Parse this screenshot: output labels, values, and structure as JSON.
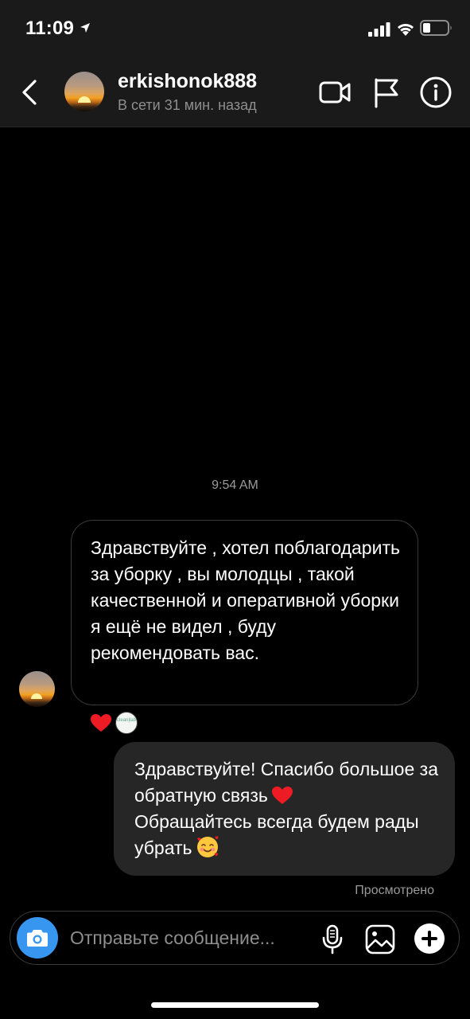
{
  "status_bar": {
    "time": "11:09",
    "icons": [
      "location-arrow-icon",
      "cellular-signal-icon",
      "wifi-icon",
      "battery-icon"
    ]
  },
  "header": {
    "username": "erkishonok888",
    "presence": "В сети 31 мин. назад",
    "icons": [
      "back-chevron-icon",
      "video-call-icon",
      "flag-icon",
      "info-icon"
    ]
  },
  "chat": {
    "timestamp": "9:54 AM",
    "messages": [
      {
        "direction": "incoming",
        "text": "Здравствуйте , хотел поблагодарить за уборку , вы молодцы , такой качественной и оперативной уборки я ещё не видел , буду рекомендовать вас.",
        "reactions": [
          "red-heart-icon",
          "reactor-avatar"
        ],
        "reactor_avatar_text": "clean|lab"
      },
      {
        "direction": "outgoing",
        "text_line1": "Здравствуйте! Спасибо большое за обратную связь",
        "text_line2": "Обращайтесь всегда будем рады убрать",
        "emojis": [
          "red-heart-icon",
          "smiling-face-with-hearts-icon"
        ]
      }
    ],
    "seen_label": "Просмотрено"
  },
  "composer": {
    "placeholder": "Отправьте сообщение...",
    "icons": [
      "camera-icon",
      "microphone-icon",
      "gallery-icon",
      "plus-icon"
    ]
  },
  "colors": {
    "background": "#000000",
    "bar_background": "#1a1a1a",
    "outgoing_bubble": "#262626",
    "camera_accent": "#3797f0",
    "heart": "#ed1c24"
  }
}
